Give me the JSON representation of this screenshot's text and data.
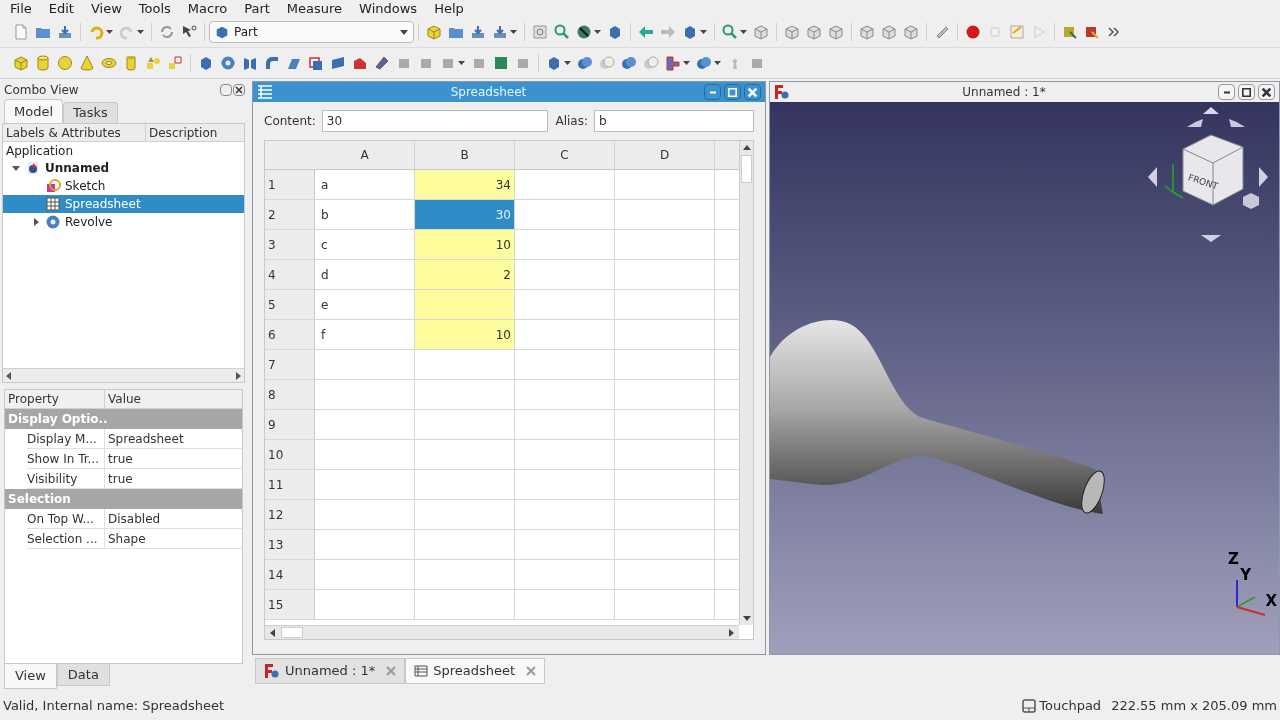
{
  "menu": [
    "File",
    "Edit",
    "View",
    "Tools",
    "Macro",
    "Part",
    "Measure",
    "Windows",
    "Help"
  ],
  "workbench": "Part",
  "combo_view": {
    "title": "Combo View",
    "tabs": [
      {
        "label": "Model",
        "selected": true
      },
      {
        "label": "Tasks",
        "selected": false
      }
    ],
    "tree": {
      "columns": [
        "Labels & Attributes",
        "Description"
      ],
      "root": "Application",
      "items": [
        {
          "label": "Unnamed",
          "kind": "document",
          "expanded": true,
          "selected": false,
          "children": [
            {
              "label": "Sketch",
              "kind": "sketch",
              "selected": false
            },
            {
              "label": "Spreadsheet",
              "kind": "spreadsheet",
              "selected": true
            },
            {
              "label": "Revolve",
              "kind": "revolve",
              "expanded": false,
              "selected": false
            }
          ]
        }
      ]
    },
    "properties": {
      "columns": [
        "Property",
        "Value"
      ],
      "groups": [
        {
          "name": "Display Optio..",
          "rows": [
            {
              "property": "Display M...",
              "value": "Spreadsheet"
            },
            {
              "property": "Show In Tr...",
              "value": "true"
            },
            {
              "property": "Visibility",
              "value": "true"
            }
          ]
        },
        {
          "name": "Selection",
          "rows": [
            {
              "property": "On Top W...",
              "value": "Disabled"
            },
            {
              "property": "Selection ...",
              "value": "Shape"
            }
          ]
        }
      ]
    },
    "bottom_tabs": [
      {
        "label": "View",
        "selected": true
      },
      {
        "label": "Data",
        "selected": false
      }
    ]
  },
  "spreadsheet": {
    "title": "Spreadsheet",
    "content_label": "Content:",
    "content": "30",
    "alias_label": "Alias:",
    "alias": "b",
    "columns": [
      "A",
      "B",
      "C",
      "D"
    ],
    "rows": [
      {
        "header": "1",
        "label": "a",
        "value": "34",
        "highlighted": true,
        "selected": false
      },
      {
        "header": "2",
        "label": "b",
        "value": "30",
        "selected": true
      },
      {
        "header": "3",
        "label": "c",
        "value": "10",
        "highlighted": true,
        "selected": false
      },
      {
        "header": "4",
        "label": "d",
        "value": "2",
        "highlighted": true,
        "selected": false
      },
      {
        "header": "5",
        "label": "e",
        "highlighted": true,
        "selected": false
      },
      {
        "header": "6",
        "label": "f",
        "value": "10",
        "highlighted": true,
        "selected": false
      },
      {
        "header": "7",
        "highlighted": false,
        "selected": false
      },
      {
        "header": "8",
        "highlighted": false,
        "selected": false
      },
      {
        "header": "9",
        "highlighted": false,
        "selected": false
      },
      {
        "header": "10",
        "highlighted": false,
        "selected": false
      },
      {
        "header": "11",
        "highlighted": false,
        "selected": false
      },
      {
        "header": "12",
        "highlighted": false,
        "selected": false
      },
      {
        "header": "13",
        "highlighted": false,
        "selected": false
      },
      {
        "header": "14",
        "highlighted": false,
        "selected": false
      },
      {
        "header": "15",
        "highlighted": false,
        "selected": false
      }
    ]
  },
  "view3d": {
    "title": "Unnamed : 1*",
    "cube_face": "FRONT",
    "axes": [
      "Z",
      "Y",
      "X"
    ]
  },
  "document_tabs": [
    {
      "label": "Unnamed : 1*",
      "kind": "document",
      "selected": false
    },
    {
      "label": "Spreadsheet",
      "kind": "spreadsheet",
      "selected": true
    }
  ],
  "status_bar": {
    "message": "Valid, Internal name: Spreadsheet",
    "navigation": "Touchpad",
    "dimensions": "222.55 mm x 205.09 mm"
  }
}
